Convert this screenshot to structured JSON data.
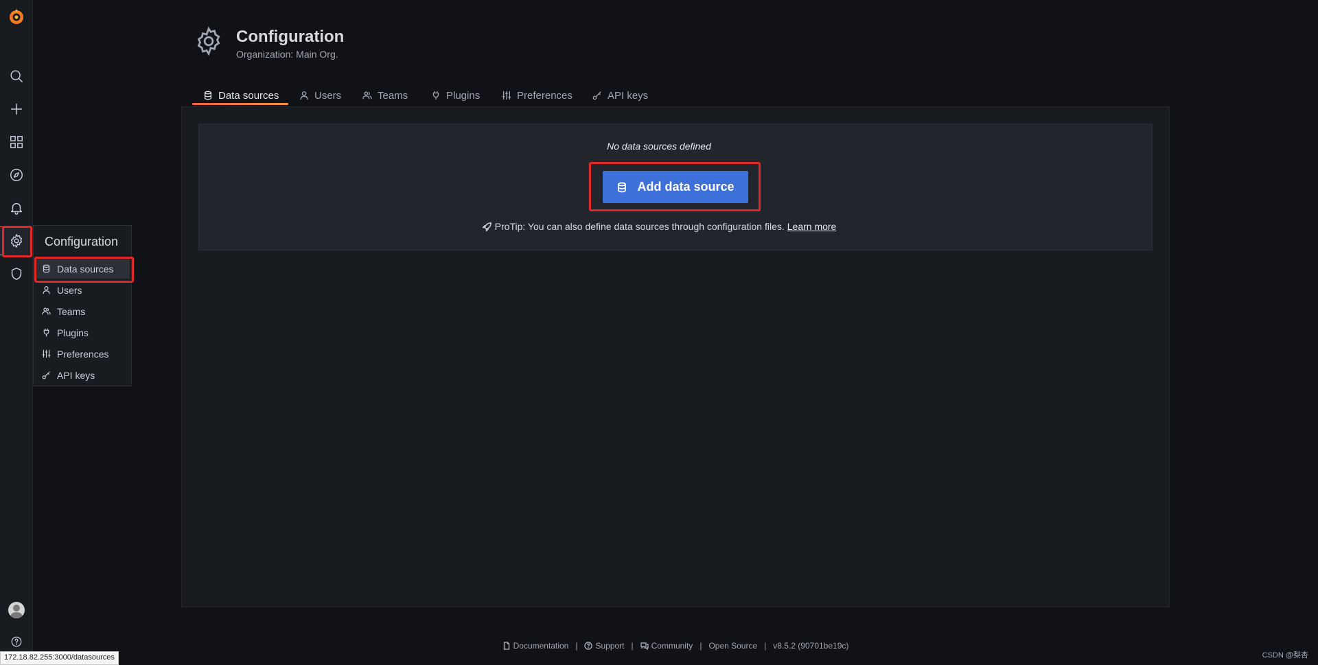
{
  "sidebar": {
    "icons": [
      "grafana-logo",
      "search-icon",
      "plus-icon",
      "dashboards-icon",
      "explore-icon",
      "alerting-icon",
      "configuration-icon",
      "shield-icon",
      "avatar",
      "help-icon"
    ]
  },
  "flyout": {
    "title": "Configuration",
    "items": [
      {
        "label": "Data sources",
        "icon": "database-icon"
      },
      {
        "label": "Users",
        "icon": "user-icon"
      },
      {
        "label": "Teams",
        "icon": "users-icon"
      },
      {
        "label": "Plugins",
        "icon": "plug-icon"
      },
      {
        "label": "Preferences",
        "icon": "sliders-icon"
      },
      {
        "label": "API keys",
        "icon": "key-icon"
      }
    ]
  },
  "header": {
    "title": "Configuration",
    "subtitle": "Organization: Main Org."
  },
  "tabs": [
    {
      "label": "Data sources",
      "active": true
    },
    {
      "label": "Users"
    },
    {
      "label": "Teams"
    },
    {
      "label": "Plugins"
    },
    {
      "label": "Preferences"
    },
    {
      "label": "API keys"
    }
  ],
  "empty": {
    "message": "No data sources defined",
    "button_label": "Add data source",
    "protip": "ProTip: You can also define data sources through configuration files.",
    "learn_more": "Learn more"
  },
  "footer": {
    "documentation": "Documentation",
    "support": "Support",
    "community": "Community",
    "open_source": "Open Source",
    "version": "v8.5.2 (90701be19c)",
    "separator": "|"
  },
  "status_url": "172.18.82.255:3000/datasources",
  "watermark": "CSDN @梨杏",
  "colors": {
    "background": "#111217",
    "panel": "#181b1f",
    "primary_button": "#3d71d9",
    "active_gradient": "#f55f3e",
    "highlight_box": "#e02828"
  }
}
